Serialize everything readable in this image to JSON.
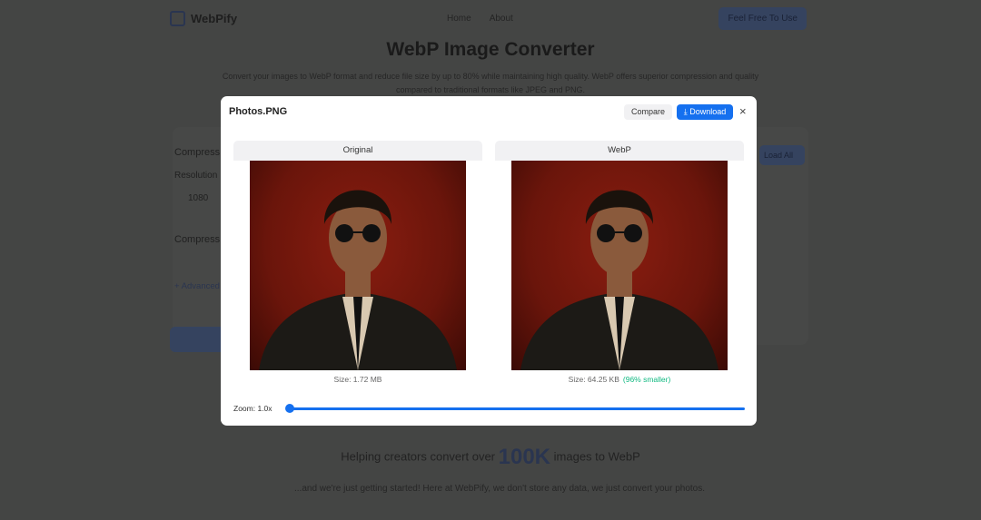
{
  "background": {
    "brand": "WebPify",
    "nav": [
      "Home",
      "About"
    ],
    "cta": "Feel Free To Use",
    "title": "WebP Image Converter",
    "subtitle": "Convert your images to WebP format and reduce file size by up to 80% while maintaining high quality. WebP offers superior compression and quality compared to traditional formats like JPEG and PNG.",
    "left": [
      "Compress",
      "Resolution",
      "1080",
      "Compress",
      "+ Advanced"
    ],
    "load_all": "Load All",
    "stats_prefix": "Helping creators convert over",
    "stats_number": "100K",
    "stats_suffix": "images to WebP",
    "note": "...and we're just getting started! Here at WebPify, we don't store any data, we just convert your photos."
  },
  "modal": {
    "title": "Photos.PNG",
    "compare": "Compare",
    "download": "Download",
    "close": "×",
    "original": {
      "label": "Original",
      "size": "Size: 1.72 MB"
    },
    "webp": {
      "label": "WebP",
      "size": "Size: 64.25 KB",
      "savings": "(96% smaller)"
    },
    "zoom_label": "Zoom: 1.0x",
    "zoom_value": 1.0
  },
  "colors": {
    "accent": "#1570ef",
    "success": "#10b981"
  }
}
